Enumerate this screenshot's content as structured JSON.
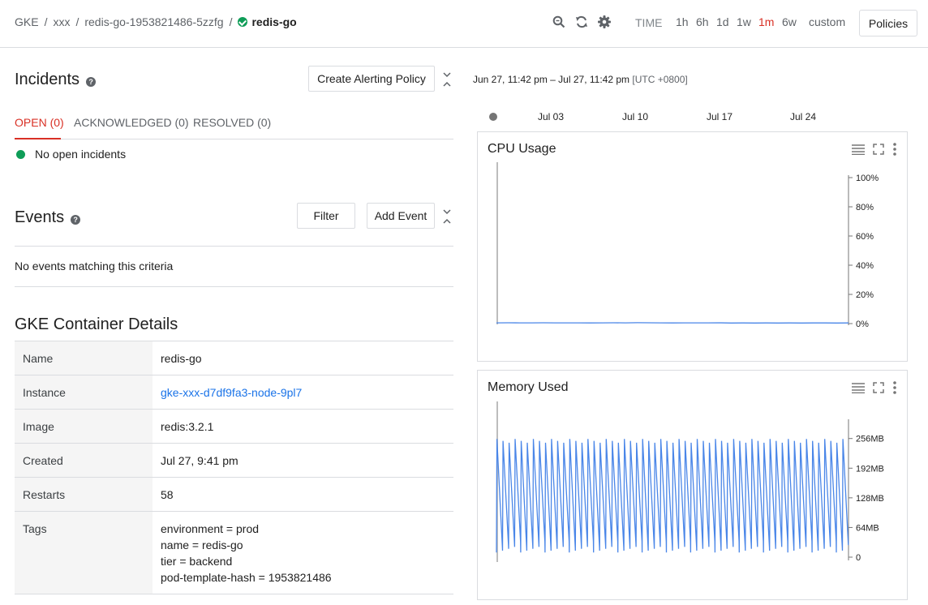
{
  "breadcrumb": {
    "items": [
      "GKE",
      "xxx",
      "redis-go-1953821486-5zzfg"
    ],
    "current": "redis-go",
    "separator": "/"
  },
  "toolbar": {
    "icons": [
      "search-icon",
      "refresh-icon",
      "settings-icon"
    ],
    "time_label": "TIME",
    "ranges": [
      "1h",
      "6h",
      "1d",
      "1w",
      "1m",
      "6w",
      "custom"
    ],
    "active_range": "1m",
    "policies_label": "Policies"
  },
  "incidents": {
    "title": "Incidents",
    "create_button": "Create Alerting Policy",
    "tabs": [
      "OPEN (0)",
      "ACKNOWLEDGED (0)",
      "RESOLVED (0)"
    ],
    "active_tab": "OPEN (0)",
    "status": "No open incidents"
  },
  "events": {
    "title": "Events",
    "filter_button": "Filter",
    "add_button": "Add Event",
    "empty_message": "No events matching this criteria"
  },
  "details": {
    "title": "GKE Container Details",
    "rows": [
      {
        "key": "Name",
        "value": "redis-go"
      },
      {
        "key": "Instance",
        "value": "gke-xxx-d7df9fa3-node-9pl7",
        "link": true
      },
      {
        "key": "Image",
        "value": "redis:3.2.1"
      },
      {
        "key": "Created",
        "value": "Jul 27, 9:41 pm"
      },
      {
        "key": "Restarts",
        "value": "58"
      },
      {
        "key": "Tags",
        "value": "environment = prod\nname = redis-go\ntier = backend\npod-template-hash = 1953821486"
      }
    ]
  },
  "time_window": {
    "range": "Jun 27, 11:42 pm – Jul 27, 11:42 pm",
    "timezone": "[UTC +0800]",
    "timeline_labels": [
      "Jul 03",
      "Jul 10",
      "Jul 17",
      "Jul 24"
    ]
  },
  "colors": {
    "accent_red": "#d93025",
    "link_blue": "#1a73e8",
    "ok_green": "#0f9d58",
    "series_blue": "#4a86e8"
  },
  "chart_data": [
    {
      "type": "line",
      "title": "CPU Usage",
      "ylabel": "",
      "yticks": [
        "0%",
        "20%",
        "40%",
        "60%",
        "80%",
        "100%"
      ],
      "ylim": [
        0,
        100
      ],
      "x_range": [
        "Jun 27",
        "Jul 27"
      ],
      "series": [
        {
          "values": [
            0.5,
            0.55,
            0.5,
            0.48,
            0.55,
            0.5,
            0.5,
            0.52,
            0.45,
            0.5,
            0.53,
            0.5,
            0.6,
            0.55,
            0.5,
            0.45,
            0.5,
            0.48,
            0.5,
            0.55,
            0.4,
            0.45,
            0.4,
            0.45,
            0.4,
            0.42,
            0.4,
            0.45,
            0.42,
            0.4,
            0.45
          ]
        }
      ]
    },
    {
      "type": "line",
      "title": "Memory Used",
      "ylabel": "",
      "yticks": [
        "0",
        "64MB",
        "128MB",
        "192MB",
        "256MB"
      ],
      "ylim": [
        0,
        280
      ],
      "x_range": [
        "Jun 27",
        "Jul 27"
      ],
      "series": [
        {
          "pattern": "sawtooth",
          "cycles": 58,
          "min": 10,
          "max": 255
        }
      ]
    }
  ]
}
